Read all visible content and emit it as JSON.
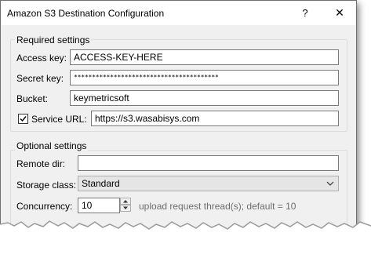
{
  "window": {
    "title": "Amazon S3 Destination Configuration",
    "help_glyph": "?",
    "close_glyph": "✕"
  },
  "required": {
    "label": "Required settings",
    "access_key_label": "Access key:",
    "access_key_value": "ACCESS-KEY-HERE",
    "secret_key_label": "Secret key:",
    "secret_key_value": "****************************************",
    "bucket_label": "Bucket:",
    "bucket_value": "keymetricsoft",
    "service_url_label": "Service URL:",
    "service_url_checked": true,
    "service_url_value": "https://s3.wasabisys.com"
  },
  "optional": {
    "label": "Optional settings",
    "remote_dir_label": "Remote dir:",
    "remote_dir_value": "",
    "storage_class_label": "Storage class:",
    "storage_class_value": "Standard",
    "concurrency_label": "Concurrency:",
    "concurrency_value": "10",
    "concurrency_hint": "upload request thread(s); default = 10"
  },
  "colors": {
    "dialog_bg": "#f0f0f0",
    "hint_text": "#6d6d6d"
  }
}
